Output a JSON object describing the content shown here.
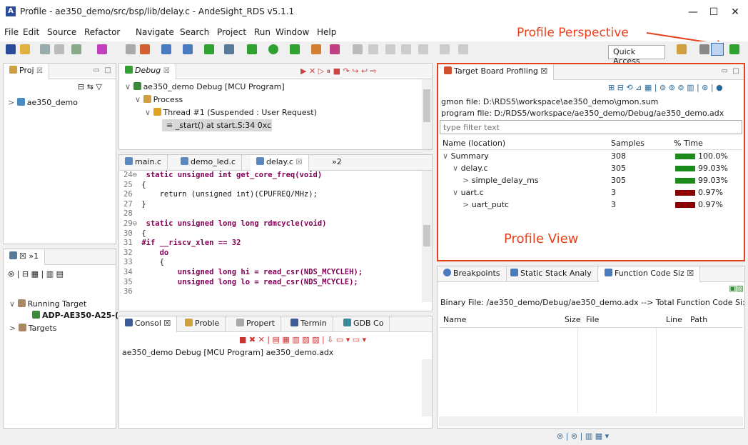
{
  "window": {
    "title": "Profile - ae350_demo/src/bsp/lib/delay.c - AndeSight_RDS v5.1.1",
    "minimize": "—",
    "maximize": "☐",
    "close": "✕"
  },
  "menu": [
    "File",
    "Edit",
    "Source",
    "Refactor",
    "Navigate",
    "Search",
    "Project",
    "Run",
    "Window",
    "Help"
  ],
  "toolbar": {
    "quick_access": "Quick Access"
  },
  "annotations": {
    "perspective": "Profile Perspective",
    "view": "Profile View"
  },
  "project_panel": {
    "tab": "Proj",
    "tab_close": "☒",
    "item": "ae350_demo"
  },
  "debug_panel": {
    "tab": "Debug",
    "tab_close": "☒",
    "items": [
      "ae350_demo Debug [MCU Program]",
      "Process",
      "Thread #1 (Suspended : User Request)",
      "_start() at start.S:34 0xc"
    ]
  },
  "editor": {
    "tabs": [
      "main.c",
      "demo_led.c",
      "delay.c",
      "»2"
    ],
    "lines": [
      {
        "n": "24⊖",
        "t": "static unsigned int get_core_freq(void)"
      },
      {
        "n": "25",
        "t": "{"
      },
      {
        "n": "26",
        "t": "    return (unsigned int)(CPUFREQ/MHz);"
      },
      {
        "n": "27",
        "t": "}"
      },
      {
        "n": "28",
        "t": ""
      },
      {
        "n": "29⊖",
        "t": "static unsigned long long rdmcycle(void)"
      },
      {
        "n": "30",
        "t": "{"
      },
      {
        "n": "31",
        "t": "#if __riscv_xlen == 32"
      },
      {
        "n": "32",
        "t": "    do"
      },
      {
        "n": "33",
        "t": "    {"
      },
      {
        "n": "34",
        "t": "        unsigned long hi = read_csr(NDS_MCYCLEH);"
      },
      {
        "n": "35",
        "t": "        unsigned long lo = read_csr(NDS_MCYCLE);"
      },
      {
        "n": "36",
        "t": ""
      }
    ]
  },
  "targets_panel": {
    "tab": "»1",
    "items": [
      "Running Target",
      "ADP-AE350-A25-(",
      "Targets"
    ]
  },
  "console_panel": {
    "tabs": [
      "Consol",
      "Proble",
      "Propert",
      "Termin",
      "GDB Co"
    ],
    "text": "ae350_demo Debug [MCU Program] ae350_demo.adx"
  },
  "profiling": {
    "tab": "Target Board Profiling",
    "gmon": "gmon file: D:\\RDS5\\workspace\\ae350_demo\\gmon.sum",
    "program": "program file: D:/RDS5/workspace/ae350_demo/Debug/ae350_demo.adx",
    "filter_placeholder": "type filter text",
    "columns": [
      "Name (location)",
      "Samples",
      "% Time"
    ],
    "rows": [
      {
        "name": "Summary",
        "samples": "308",
        "time": "100.0%",
        "pct": 100,
        "color": "#1a8a1a",
        "indent": 0,
        "exp": "∨"
      },
      {
        "name": "delay.c",
        "samples": "305",
        "time": "99.03%",
        "pct": 99.03,
        "color": "#1a8a1a",
        "indent": 1,
        "exp": "∨"
      },
      {
        "name": "simple_delay_ms",
        "samples": "305",
        "time": "99.03%",
        "pct": 99.03,
        "color": "#1a8a1a",
        "indent": 2,
        "exp": ">"
      },
      {
        "name": "uart.c",
        "samples": "3",
        "time": "0.97%",
        "pct": 0.97,
        "color": "#8b0000",
        "indent": 1,
        "exp": "∨"
      },
      {
        "name": "uart_putc",
        "samples": "3",
        "time": "0.97%",
        "pct": 0.97,
        "color": "#8b0000",
        "indent": 2,
        "exp": ">"
      }
    ]
  },
  "bottom_right": {
    "tabs": [
      "Breakpoints",
      "Static Stack Analy",
      "Function Code Siz"
    ],
    "binary": "Binary File: /ae350_demo/Debug/ae350_demo.adx -->  Total Function Code Si:",
    "columns": [
      "Name",
      "Size",
      "File",
      "Line",
      "Path"
    ]
  },
  "colors": {
    "accent_red": "#e8401a",
    "bar_green": "#1a8a1a",
    "bar_red": "#8b0000"
  }
}
